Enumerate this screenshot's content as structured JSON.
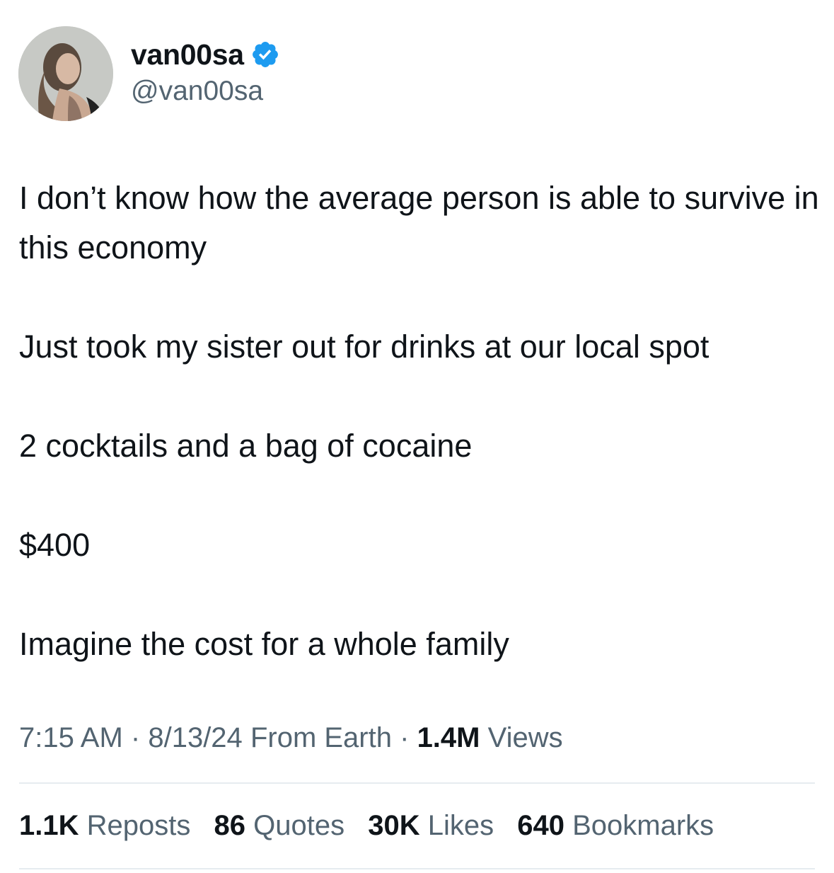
{
  "colors": {
    "text_primary": "#0f1419",
    "text_secondary": "#536471",
    "verified_blue": "#1d9bf0",
    "divider": "#e6ecf0"
  },
  "author": {
    "display_name": "van00sa",
    "handle": "@van00sa",
    "verified_icon": "verified-badge-icon",
    "avatar_icon": "profile-photo"
  },
  "tweet": {
    "paragraphs": [
      "I don’t know how the average person is able to survive in this economy",
      "Just took my sister out for drinks at our local spot",
      "2 cocktails and a bag of cocaine",
      "$400",
      "Imagine the cost for a whole family"
    ]
  },
  "meta": {
    "time": "7:15 AM",
    "date": "8/13/24",
    "location": "From Earth",
    "separator": "·",
    "views_count": "1.4M",
    "views_label": "Views"
  },
  "stats": [
    {
      "count": "1.1K",
      "label": "Reposts"
    },
    {
      "count": "86",
      "label": "Quotes"
    },
    {
      "count": "30K",
      "label": "Likes"
    },
    {
      "count": "640",
      "label": "Bookmarks"
    }
  ]
}
